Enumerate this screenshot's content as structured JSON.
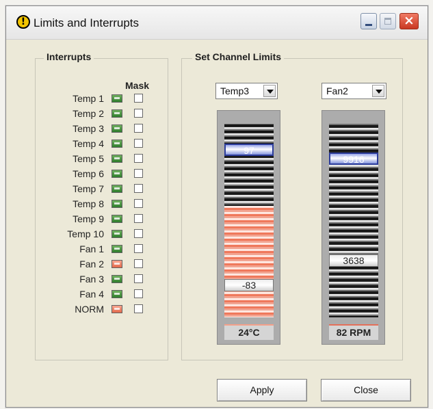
{
  "window": {
    "title": "Limits and Interrupts",
    "icon": "exclamation-icon",
    "controls": [
      "minimize-icon",
      "maximize-icon",
      "close-icon"
    ],
    "colors": {
      "title_icon": "#f2c400",
      "close": "#d64a31"
    }
  },
  "interrupts": {
    "label": "Interrupts",
    "mask_label": "Mask",
    "rows": [
      {
        "name": "Temp 1",
        "status": "green",
        "masked": false
      },
      {
        "name": "Temp 2",
        "status": "green",
        "masked": false
      },
      {
        "name": "Temp 3",
        "status": "green",
        "masked": false
      },
      {
        "name": "Temp 4",
        "status": "green",
        "masked": false
      },
      {
        "name": "Temp 5",
        "status": "green",
        "masked": false
      },
      {
        "name": "Temp 6",
        "status": "green",
        "masked": false
      },
      {
        "name": "Temp 7",
        "status": "green",
        "masked": false
      },
      {
        "name": "Temp 8",
        "status": "green",
        "masked": false
      },
      {
        "name": "Temp 9",
        "status": "green",
        "masked": false
      },
      {
        "name": "Temp 10",
        "status": "green",
        "masked": false
      },
      {
        "name": "Fan 1",
        "status": "green",
        "masked": false
      },
      {
        "name": "Fan 2",
        "status": "red",
        "masked": false
      },
      {
        "name": "Fan 3",
        "status": "green",
        "masked": false
      },
      {
        "name": "Fan 4",
        "status": "green",
        "masked": false
      },
      {
        "name": "NORM",
        "status": "red",
        "masked": false
      }
    ],
    "colors": {
      "green": "#3f8f38",
      "red": "#ef785b"
    }
  },
  "limits": {
    "label": "Set Channel Limits",
    "temp_channel": "Temp3",
    "fan_channel": "Fan2",
    "temp_high": "97",
    "temp_low": "-83",
    "temp_reading": "24°C",
    "fan_high": "9916",
    "fan_low": "3638",
    "fan_reading": "82 RPM"
  },
  "buttons": {
    "apply": "Apply",
    "close": "Close"
  }
}
